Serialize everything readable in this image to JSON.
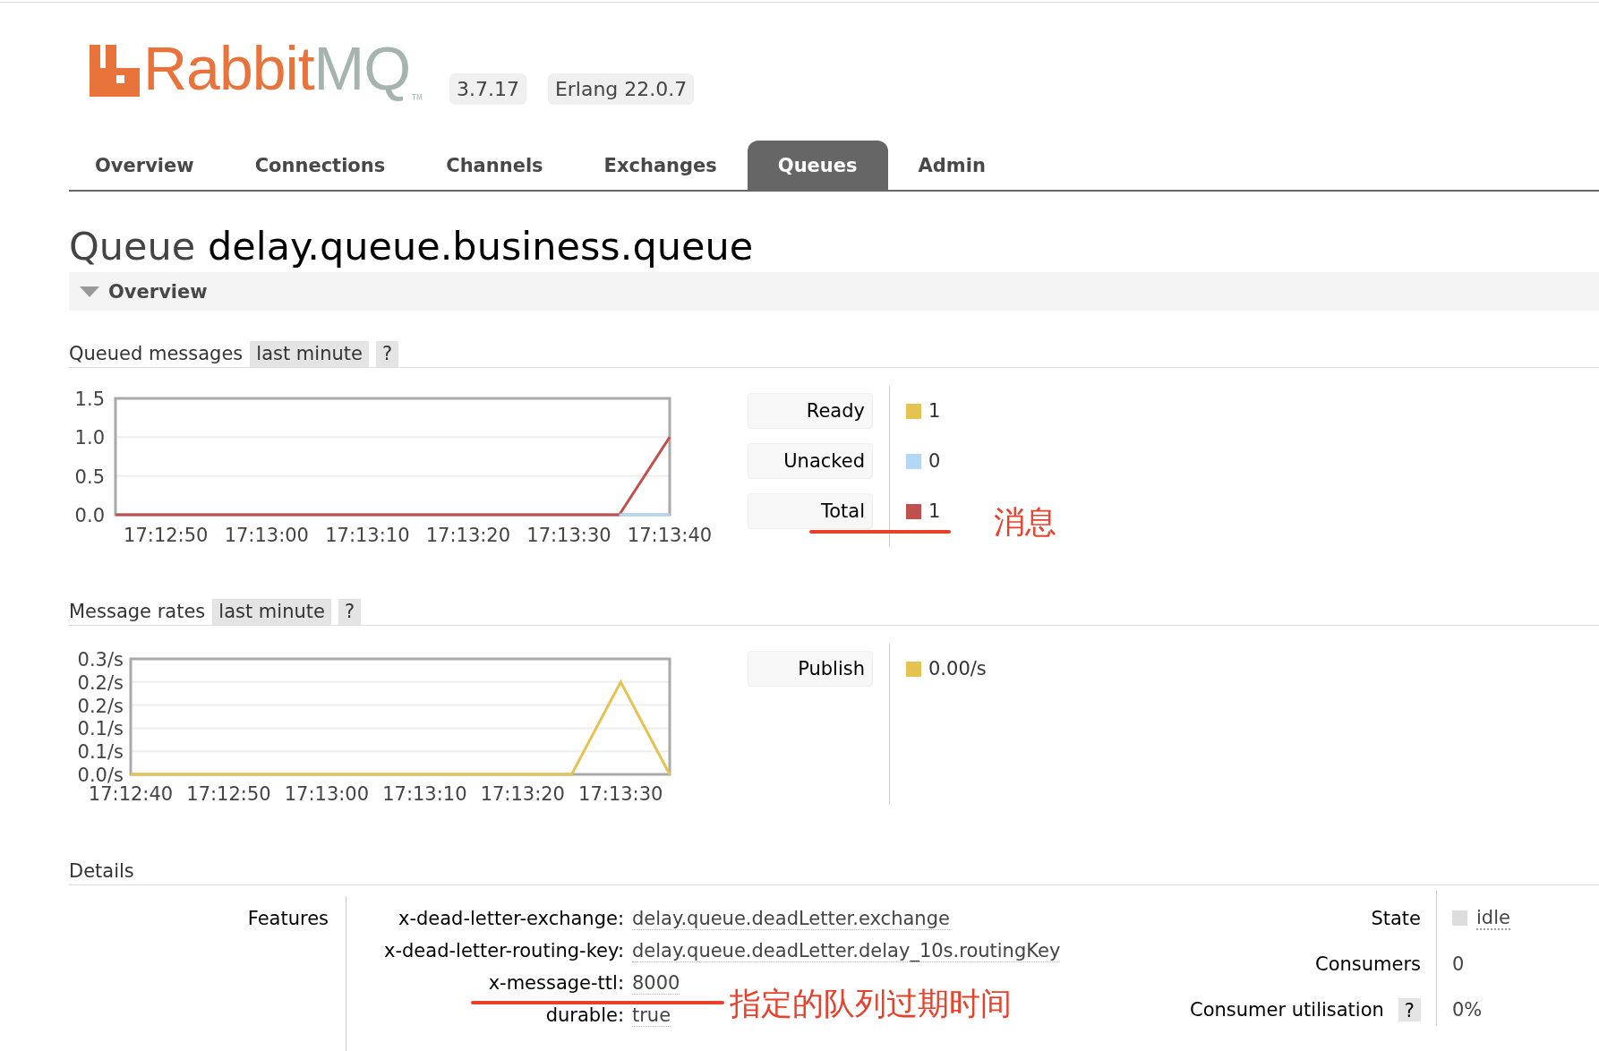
{
  "logo": {
    "name": "Rabbit",
    "suffix": "MQ",
    "trademark": "TM"
  },
  "badges": [
    "3.7.17",
    "Erlang 22.0.7"
  ],
  "tabs": [
    {
      "label": "Overview",
      "selected": false
    },
    {
      "label": "Connections",
      "selected": false
    },
    {
      "label": "Channels",
      "selected": false
    },
    {
      "label": "Exchanges",
      "selected": false
    },
    {
      "label": "Queues",
      "selected": true
    },
    {
      "label": "Admin",
      "selected": false
    }
  ],
  "page_title": {
    "prefix": "Queue",
    "name": "delay.queue.business.queue"
  },
  "overview_section": {
    "label": "Overview",
    "expanded": true
  },
  "sections": [
    {
      "title": "Queued messages",
      "range": "last minute",
      "help": "?",
      "chart_data": {
        "type": "line",
        "grid": true,
        "ylim": [
          0,
          1.5
        ],
        "categories": [
          null,
          "17:12:50",
          null,
          "17:13:00",
          null,
          "17:13:10",
          null,
          "17:13:20",
          null,
          "17:13:30",
          null,
          "17:13:40"
        ],
        "yticks": [
          {
            "value": 0,
            "label": "0.0"
          },
          {
            "value": 0.5,
            "label": "0.5"
          },
          {
            "value": 1,
            "label": "1.0"
          },
          {
            "value": 1.5,
            "label": "1.5"
          }
        ],
        "series": [
          {
            "color": "#c0504d",
            "values": [
              0,
              0,
              0,
              0,
              0,
              0,
              0,
              0,
              0,
              0,
              0,
              1
            ]
          },
          {
            "color": "#b3d7f5",
            "values": [
              null,
              null,
              null,
              null,
              null,
              null,
              null,
              null,
              null,
              null,
              0,
              0
            ]
          }
        ]
      },
      "legend": [
        {
          "label": "Ready",
          "color": "#e6c251",
          "value": "1"
        },
        {
          "label": "Unacked",
          "color": "#b3d7f5",
          "value": "0"
        },
        {
          "label": "Total",
          "color": "#c0504d",
          "value": "1"
        }
      ]
    },
    {
      "title": "Message rates",
      "range": "last minute",
      "help": "?",
      "chart_data": {
        "type": "line",
        "grid": true,
        "ylim": [
          0,
          0.25
        ],
        "categories": [
          "17:12:40",
          null,
          "17:12:50",
          null,
          "17:13:00",
          null,
          "17:13:10",
          null,
          "17:13:20",
          null,
          "17:13:30",
          null
        ],
        "yticks": [
          {
            "value": 0,
            "label": "0.0/s"
          },
          {
            "value": 0.05,
            "label": "0.1/s"
          },
          {
            "value": 0.1,
            "label": "0.1/s"
          },
          {
            "value": 0.15,
            "label": "0.2/s"
          },
          {
            "value": 0.2,
            "label": "0.2/s"
          },
          {
            "value": 0.25,
            "label": "0.3/s"
          }
        ],
        "series": [
          {
            "color": "#e6c251",
            "values": [
              0,
              0,
              0,
              0,
              0,
              0,
              0,
              0,
              0,
              0,
              0.2,
              0
            ]
          }
        ]
      },
      "legend": [
        {
          "label": "Publish",
          "color": "#e6c251",
          "value": "0.00/s"
        }
      ]
    }
  ],
  "details": {
    "title": "Details",
    "features_label": "Features",
    "features": [
      {
        "key": "x-dead-letter-exchange:",
        "value": "delay.queue.deadLetter.exchange"
      },
      {
        "key": "x-dead-letter-routing-key:",
        "value": "delay.queue.deadLetter.delay_10s.routingKey"
      },
      {
        "key": "x-message-ttl:",
        "value": "8000"
      },
      {
        "key": "durable:",
        "value": "true"
      }
    ],
    "stats": [
      {
        "kind": "state",
        "label": "State",
        "value": "idle"
      },
      {
        "kind": "plain",
        "label": "Consumers",
        "value": "0"
      },
      {
        "kind": "help",
        "label": "Consumer utilisation",
        "help": "?",
        "value": "0%"
      }
    ]
  },
  "annotations": [
    {
      "text": "消息"
    },
    {
      "text": "指定的队列过期时间"
    }
  ]
}
